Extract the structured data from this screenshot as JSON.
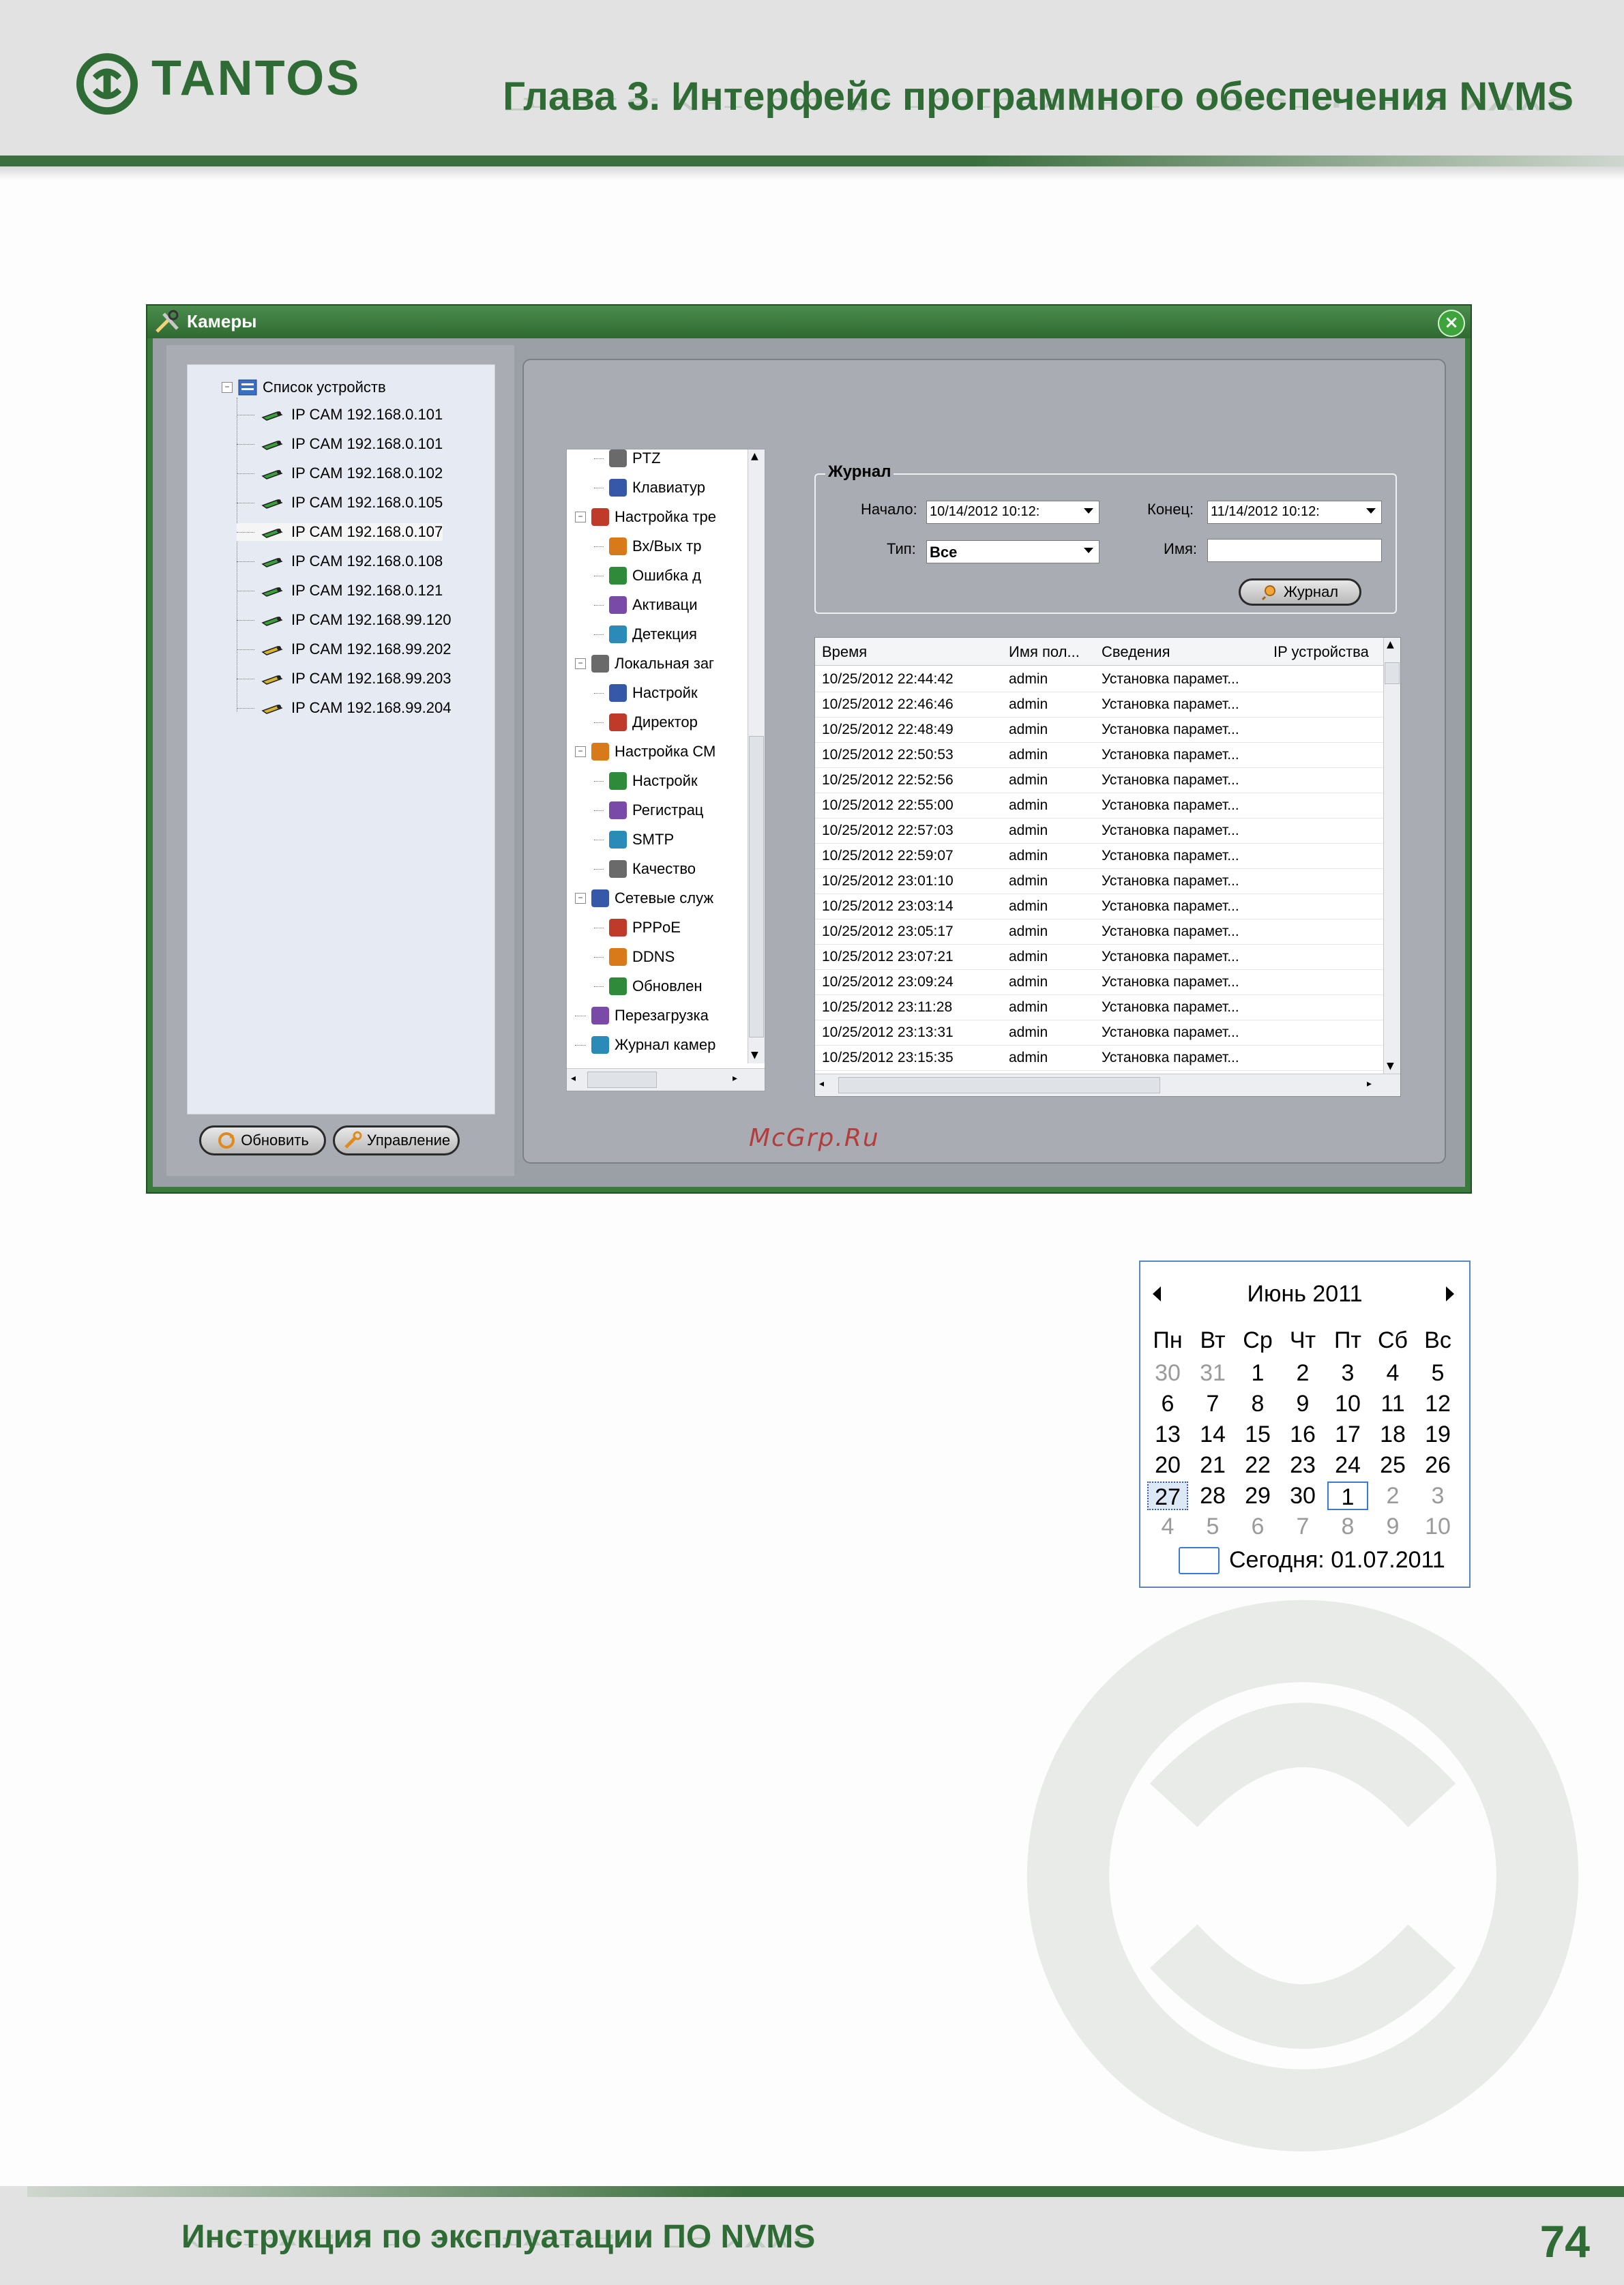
{
  "header": {
    "logo_text": "TANTOS",
    "chapter_title": "Глава 3. Интерфейс программного обеспечения NVMS"
  },
  "footer": {
    "manual_title": "Инструкция по эксплуатации ПО NVMS",
    "page_number": "74"
  },
  "window": {
    "title": "Камеры",
    "device_tree": {
      "root_label": "Список устройств",
      "devices": [
        "IP CAM 192.168.0.101",
        "IP CAM 192.168.0.101",
        "IP CAM 192.168.0.102",
        "IP CAM 192.168.0.105",
        "IP CAM 192.168.0.107",
        "IP CAM 192.168.0.108",
        "IP CAM 192.168.0.121",
        "IP CAM 192.168.99.120",
        "IP CAM 192.168.99.202",
        "IP CAM 192.168.99.203",
        "IP CAM 192.168.99.204"
      ]
    },
    "buttons": {
      "refresh": "Обновить",
      "manage": "Управление"
    },
    "menu_tree": {
      "items": [
        {
          "label": "PTZ",
          "level": 2
        },
        {
          "label": "Клавиатур",
          "level": 2
        },
        {
          "label": "Настройка тре",
          "level": 1
        },
        {
          "label": "Вх/Вых тр",
          "level": 2
        },
        {
          "label": "Ошибка д",
          "level": 2
        },
        {
          "label": "Активаци",
          "level": 2
        },
        {
          "label": "Детекция",
          "level": 2
        },
        {
          "label": "Локальная заг",
          "level": 1
        },
        {
          "label": "Настройк",
          "level": 2
        },
        {
          "label": "Директор",
          "level": 2
        },
        {
          "label": "Настройка СМ",
          "level": 1
        },
        {
          "label": "Настройк",
          "level": 2
        },
        {
          "label": "Регистрац",
          "level": 2
        },
        {
          "label": "SMTP",
          "level": 2
        },
        {
          "label": "Качество",
          "level": 2
        },
        {
          "label": "Сетевые служ",
          "level": 1
        },
        {
          "label": "PPPoE",
          "level": 2
        },
        {
          "label": "DDNS",
          "level": 2
        },
        {
          "label": "Обновлен",
          "level": 2
        },
        {
          "label": "Перезагрузка",
          "level": 1
        },
        {
          "label": "Журнал камер",
          "level": 1
        }
      ]
    },
    "journal": {
      "legend": "Журнал",
      "start_label": "Начало:",
      "start_value": "10/14/2012  10:12:",
      "end_label": "Конец:",
      "end_value": "11/14/2012  10:12:",
      "type_label": "Тип:",
      "type_value": "Все",
      "name_label": "Имя:",
      "name_value": "",
      "button_label": "Журнал"
    },
    "log_table": {
      "columns": [
        "Время",
        "Имя пол...",
        "Сведения",
        "IP устройства"
      ],
      "rows": [
        [
          "10/25/2012 22:44:42",
          "admin",
          "Установка парамет...",
          ""
        ],
        [
          "10/25/2012 22:46:46",
          "admin",
          "Установка парамет...",
          ""
        ],
        [
          "10/25/2012 22:48:49",
          "admin",
          "Установка парамет...",
          ""
        ],
        [
          "10/25/2012 22:50:53",
          "admin",
          "Установка парамет...",
          ""
        ],
        [
          "10/25/2012 22:52:56",
          "admin",
          "Установка парамет...",
          ""
        ],
        [
          "10/25/2012 22:55:00",
          "admin",
          "Установка парамет...",
          ""
        ],
        [
          "10/25/2012 22:57:03",
          "admin",
          "Установка парамет...",
          ""
        ],
        [
          "10/25/2012 22:59:07",
          "admin",
          "Установка парамет...",
          ""
        ],
        [
          "10/25/2012 23:01:10",
          "admin",
          "Установка парамет...",
          ""
        ],
        [
          "10/25/2012 23:03:14",
          "admin",
          "Установка парамет...",
          ""
        ],
        [
          "10/25/2012 23:05:17",
          "admin",
          "Установка парамет...",
          ""
        ],
        [
          "10/25/2012 23:07:21",
          "admin",
          "Установка парамет...",
          ""
        ],
        [
          "10/25/2012 23:09:24",
          "admin",
          "Установка парамет...",
          ""
        ],
        [
          "10/25/2012 23:11:28",
          "admin",
          "Установка парамет...",
          ""
        ],
        [
          "10/25/2012 23:13:31",
          "admin",
          "Установка парамет...",
          ""
        ],
        [
          "10/25/2012 23:15:35",
          "admin",
          "Установка парамет...",
          ""
        ]
      ]
    },
    "watermark": "McGrp.Ru"
  },
  "calendar": {
    "month_label": "Июнь 2011",
    "weekdays": [
      "Пн",
      "Вт",
      "Ср",
      "Чт",
      "Пт",
      "Сб",
      "Вс"
    ],
    "weeks": [
      [
        {
          "d": "30",
          "m": true
        },
        {
          "d": "31",
          "m": true
        },
        {
          "d": "1"
        },
        {
          "d": "2"
        },
        {
          "d": "3"
        },
        {
          "d": "4"
        },
        {
          "d": "5"
        }
      ],
      [
        {
          "d": "6"
        },
        {
          "d": "7"
        },
        {
          "d": "8"
        },
        {
          "d": "9"
        },
        {
          "d": "10"
        },
        {
          "d": "11"
        },
        {
          "d": "12"
        }
      ],
      [
        {
          "d": "13"
        },
        {
          "d": "14"
        },
        {
          "d": "15"
        },
        {
          "d": "16"
        },
        {
          "d": "17"
        },
        {
          "d": "18"
        },
        {
          "d": "19"
        }
      ],
      [
        {
          "d": "20"
        },
        {
          "d": "21"
        },
        {
          "d": "22"
        },
        {
          "d": "23"
        },
        {
          "d": "24"
        },
        {
          "d": "25"
        },
        {
          "d": "26"
        }
      ],
      [
        {
          "d": "27",
          "sel": true
        },
        {
          "d": "28"
        },
        {
          "d": "29"
        },
        {
          "d": "30"
        },
        {
          "d": "1",
          "today": true
        },
        {
          "d": "2",
          "m": true
        },
        {
          "d": "3",
          "m": true
        }
      ],
      [
        {
          "d": "4",
          "m": true
        },
        {
          "d": "5",
          "m": true
        },
        {
          "d": "6",
          "m": true
        },
        {
          "d": "7",
          "m": true
        },
        {
          "d": "8",
          "m": true
        },
        {
          "d": "9",
          "m": true
        },
        {
          "d": "10",
          "m": true
        }
      ]
    ],
    "today_label": "Сегодня: 01.07.2011"
  },
  "colors": {
    "brand_green": "#2f6b34",
    "window_green": "#3a7a3c"
  }
}
